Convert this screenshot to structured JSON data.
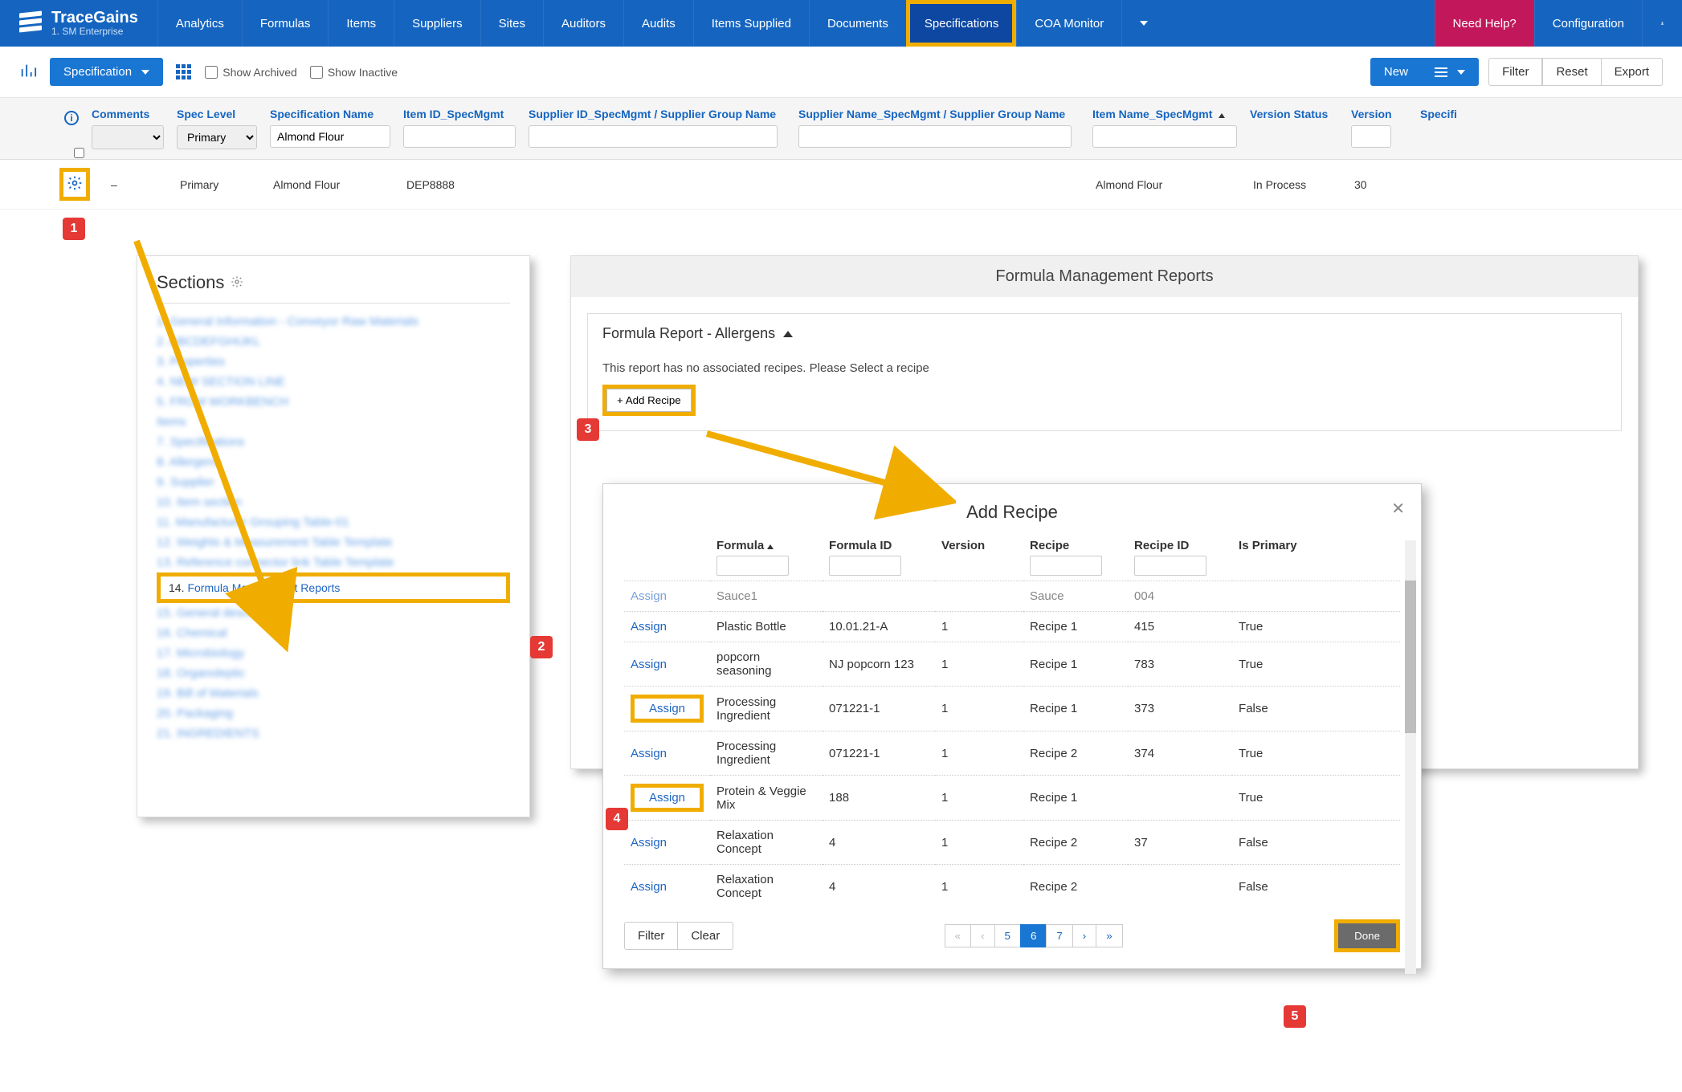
{
  "brand": {
    "name": "TraceGains",
    "sub": "1. SM Enterprise"
  },
  "nav": {
    "items": [
      "Analytics",
      "Formulas",
      "Items",
      "Suppliers",
      "Sites",
      "Auditors",
      "Audits",
      "Items Supplied",
      "Documents",
      "Specifications",
      "COA Monitor"
    ],
    "active": "Specifications",
    "help": "Need Help?",
    "config": "Configuration"
  },
  "toolbar": {
    "spec_btn": "Specification",
    "show_archived": "Show Archived",
    "show_inactive": "Show Inactive",
    "new": "New",
    "filter": "Filter",
    "reset": "Reset",
    "export": "Export"
  },
  "grid": {
    "headers": {
      "comments": "Comments",
      "spec_level": "Spec Level",
      "spec_name": "Specification Name",
      "item_id": "Item ID_SpecMgmt",
      "supplier_id": "Supplier ID_SpecMgmt / Supplier Group Name",
      "supplier_name": "Supplier Name_SpecMgmt / Supplier Group Name",
      "item_name": "Item Name_SpecMgmt",
      "version_status": "Version Status",
      "version": "Version",
      "last": "Specifi"
    },
    "filters": {
      "spec_level": "Primary",
      "spec_name": "Almond Flour"
    },
    "row": {
      "comments": "–",
      "spec_level": "Primary",
      "spec_name": "Almond Flour",
      "item_id": "DEP8888",
      "item_name": "Almond Flour",
      "version_status": "In Process",
      "version": "30"
    }
  },
  "sections": {
    "title": "Sections",
    "items": [
      "1. General Information - Conveyor Raw Materials",
      "2. ABCDEFGHIJKL",
      "3. Properties",
      "4. NEW SECTION LINE",
      "5. FROM WORKBENCH",
      "Items",
      "7. Specifications",
      "8. Allergens",
      "9. Supplier",
      "10. Item section",
      "11. Manufacturer Grouping Table-01",
      "12. Weights & Measurement Table Template",
      "13. Reference connector link Table Template"
    ],
    "active_num": "14.",
    "active": "Formula Management Reports",
    "after": [
      "15. General description",
      "16. Chemical",
      "17. Microbiology",
      "18. Organoleptic",
      "19. Bill of Materials",
      "20. Packaging",
      "21. INGREDIENTS"
    ]
  },
  "reports": {
    "title": "Formula Management Reports",
    "card_title": "Formula Report - Allergens",
    "note": "This report has no associated recipes. Please Select a recipe",
    "add_btn": "+ Add Recipe"
  },
  "modal": {
    "title": "Add Recipe",
    "headers": {
      "formula": "Formula",
      "formula_id": "Formula ID",
      "version": "Version",
      "recipe": "Recipe",
      "recipe_id": "Recipe ID",
      "is_primary": "Is Primary"
    },
    "assign": "Assign",
    "rows": [
      {
        "formula": "Sauce1",
        "formula_id": "",
        "version": "",
        "recipe": "Sauce",
        "recipe_id": "004",
        "is_primary": "",
        "partial": true
      },
      {
        "formula": "Plastic Bottle",
        "formula_id": "10.01.21-A",
        "version": "1",
        "recipe": "Recipe 1",
        "recipe_id": "415",
        "is_primary": "True"
      },
      {
        "formula": "popcorn seasoning",
        "formula_id": "NJ popcorn 123",
        "version": "1",
        "recipe": "Recipe 1",
        "recipe_id": "783",
        "is_primary": "True"
      },
      {
        "formula": "Processing Ingredient",
        "formula_id": "071221-1",
        "version": "1",
        "recipe": "Recipe 1",
        "recipe_id": "373",
        "is_primary": "False",
        "highlight": true
      },
      {
        "formula": "Processing Ingredient",
        "formula_id": "071221-1",
        "version": "1",
        "recipe": "Recipe 2",
        "recipe_id": "374",
        "is_primary": "True"
      },
      {
        "formula": "Protein & Veggie Mix",
        "formula_id": "188",
        "version": "1",
        "recipe": "Recipe 1",
        "recipe_id": "",
        "is_primary": "True",
        "highlight": true
      },
      {
        "formula": "Relaxation Concept",
        "formula_id": "4",
        "version": "1",
        "recipe": "Recipe 2",
        "recipe_id": "37",
        "is_primary": "False"
      },
      {
        "formula": "Relaxation Concept",
        "formula_id": "4",
        "version": "1",
        "recipe": "Recipe 2",
        "recipe_id": "",
        "is_primary": "False",
        "partial_bottom": true
      }
    ],
    "footer": {
      "filter": "Filter",
      "clear": "Clear",
      "pages": [
        "«",
        "‹",
        "5",
        "6",
        "7",
        "›",
        "»"
      ],
      "active_page": "6",
      "done": "Done"
    }
  },
  "callouts": {
    "1": "1",
    "2": "2",
    "3": "3",
    "4": "4",
    "5": "5"
  }
}
